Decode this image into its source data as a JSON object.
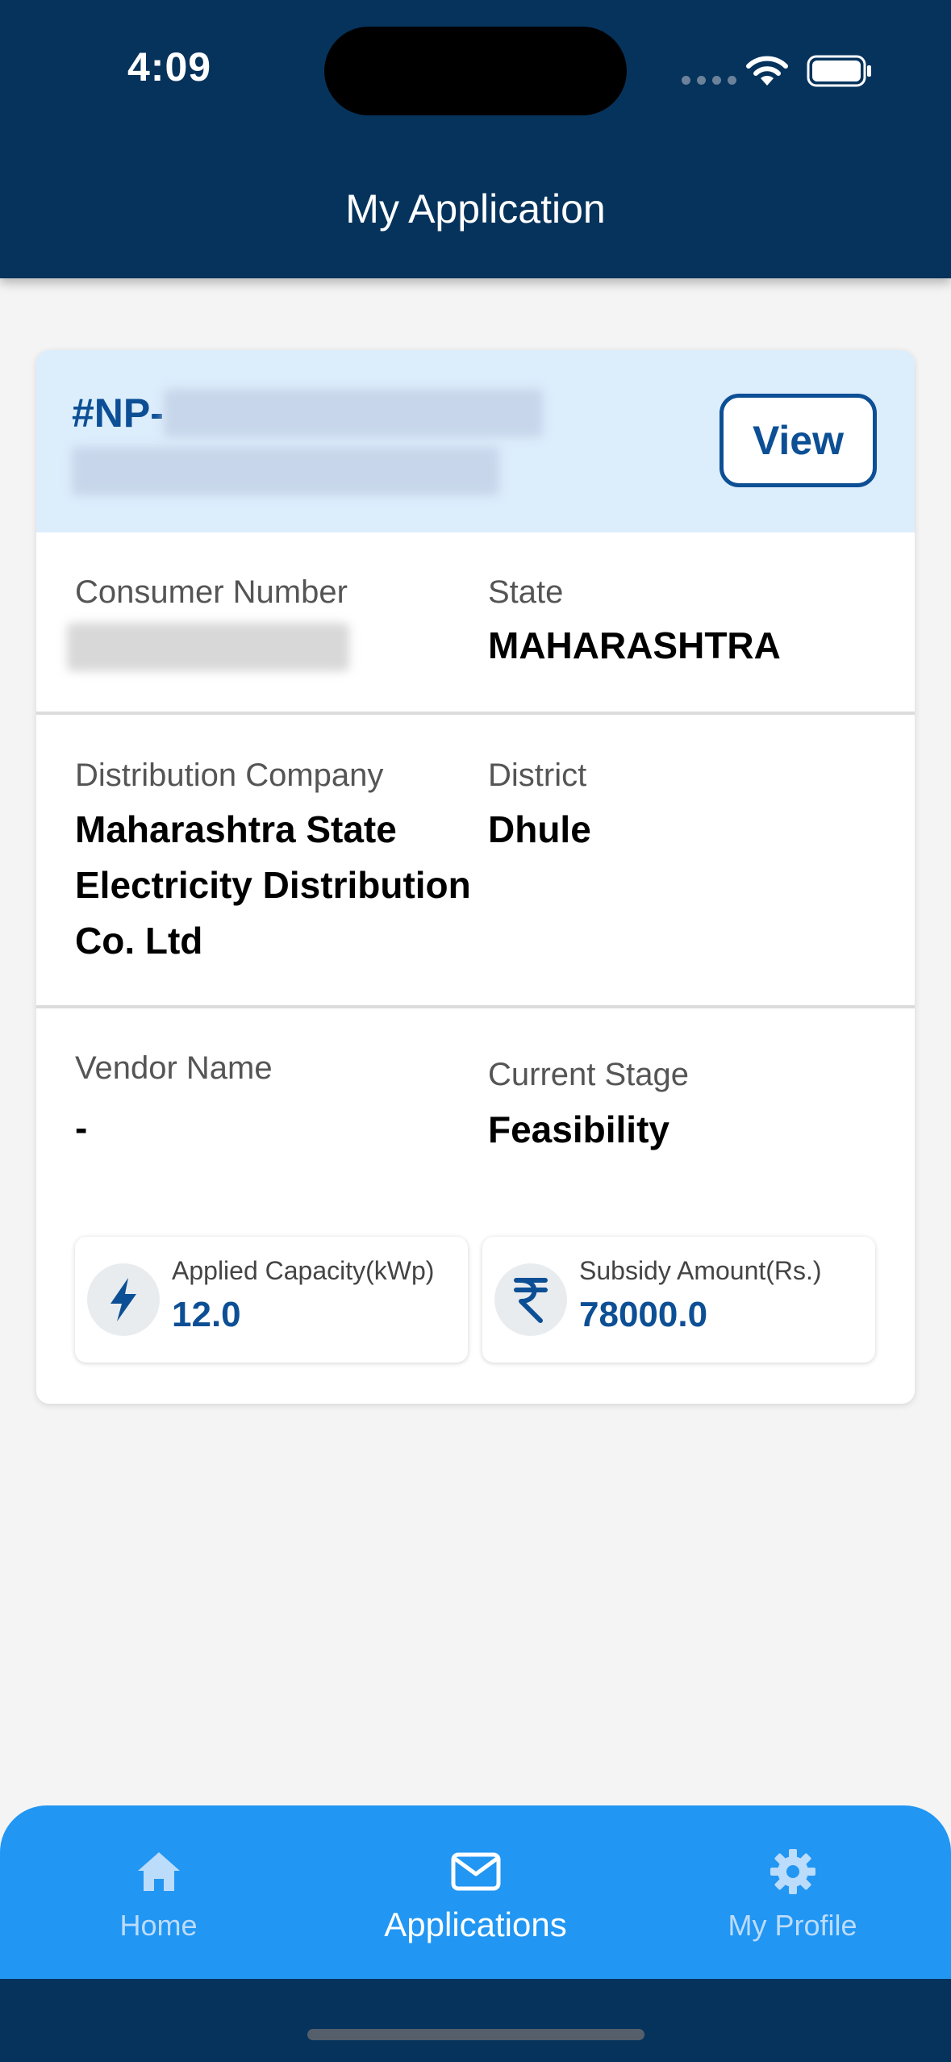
{
  "status_bar": {
    "time": "4:09"
  },
  "header": {
    "title": "My Application"
  },
  "application": {
    "id_prefix": "#NP-",
    "view_label": "View",
    "fields": {
      "consumer_number_label": "Consumer Number",
      "state_label": "State",
      "state_value": "MAHARASHTRA",
      "distribution_company_label": "Distribution Company",
      "distribution_company_value": "Maharashtra State Electricity Distribution Co. Ltd",
      "district_label": "District",
      "district_value": "Dhule",
      "vendor_name_label": "Vendor Name",
      "vendor_name_value": "-",
      "current_stage_label": "Current Stage",
      "current_stage_value": "Feasibility"
    },
    "stats": {
      "capacity_label": "Applied Capacity(kWp)",
      "capacity_value": "12.0",
      "subsidy_label": "Subsidy Amount(Rs.)",
      "subsidy_value": "78000.0"
    }
  },
  "nav": {
    "items": [
      {
        "label": "Home",
        "icon": "home-icon",
        "active": false
      },
      {
        "label": "Applications",
        "icon": "mail-icon",
        "active": true
      },
      {
        "label": "My Profile",
        "icon": "gear-icon",
        "active": false
      }
    ]
  },
  "colors": {
    "header_bg": "#06335c",
    "accent": "#0d4f95",
    "nav_bg": "#2196f3",
    "card_head_bg": "#dcedfc"
  }
}
